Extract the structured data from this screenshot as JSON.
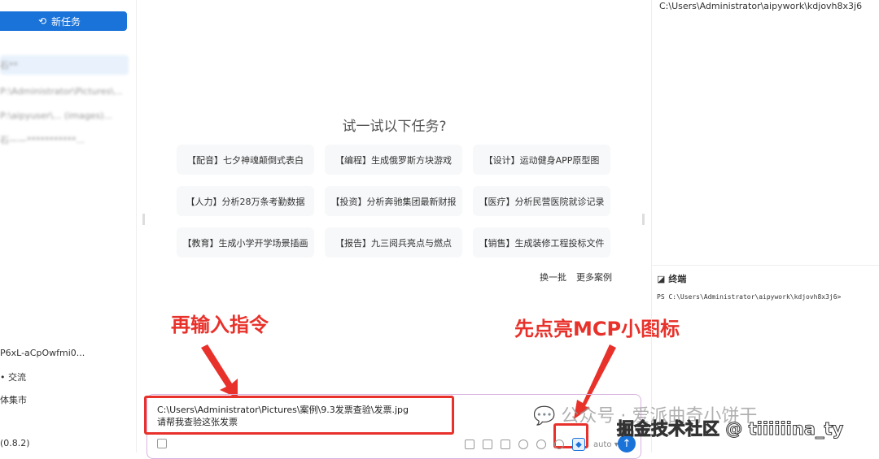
{
  "sidebar": {
    "new_task": "新任务",
    "history": [
      "石**",
      "P:\\Administrator\\Pictures\\...",
      "P:\\aipyuser\\... (images)...",
      "石——***********..."
    ],
    "bottom": [
      "P6xL-aCpOwfmi0...",
      "• 交流",
      "体集市",
      "(0.8.2)"
    ]
  },
  "main": {
    "title": "试一试以下任务?",
    "cards": [
      "【配音】七夕神魂颠倒式表白",
      "【编程】生成俄罗斯方块游戏",
      "【设计】运动健身APP原型图",
      "【人力】分析28万条考勤数据",
      "【投资】分析奔驰集团最新财报",
      "【医疗】分析民营医院就诊记录",
      "【教育】生成小学开学场景插画",
      "【报告】九三阅兵亮点与燃点",
      "【销售】生成装修工程投标文件"
    ],
    "refresh": "换一批",
    "more": "更多案例"
  },
  "input": {
    "line1": "C:\\Users\\Administrator\\Pictures\\案例\\9.3发票查验\\发票.jpg",
    "line2": "请帮我查验这张发票",
    "model": "auto"
  },
  "annotations": {
    "left": "再输入指令",
    "right": "先点亮MCP小图标"
  },
  "right_panel": {
    "path": "C:\\Users\\Administrator\\aipywork\\kdjovh8x3j6",
    "terminal_title": "终端",
    "terminal_line": "PS C:\\Users\\Administrator\\aipywork\\kdjovh8x3j6>"
  },
  "watermark": {
    "wechat": "公众号 · 爱派曲奇小饼干",
    "juejin": "掘金技术社区 @ tiiiiiina_ty"
  }
}
